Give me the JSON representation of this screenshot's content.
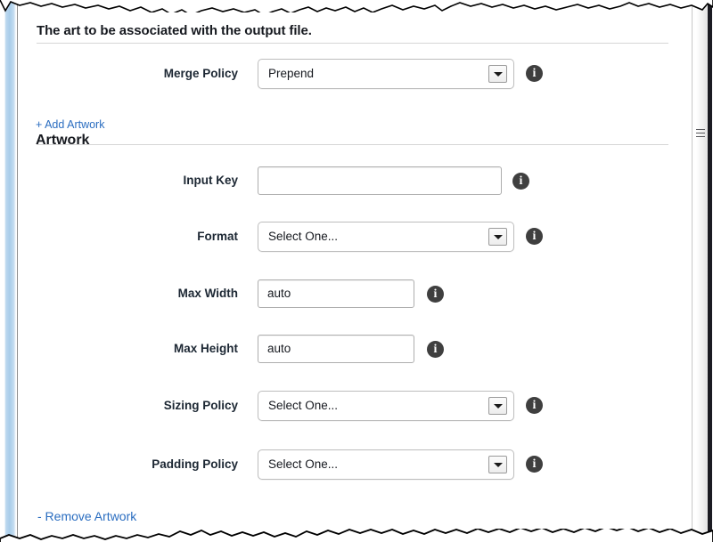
{
  "page": {
    "section_heading": "The art to be associated with the output file.",
    "subsection_heading": "Artwork",
    "add_link": "+ Add Artwork",
    "remove_link": "- Remove Artwork"
  },
  "icons": {
    "info": "info-icon",
    "caret": "chevron-down-icon",
    "scrollbar_grip": "scrollbar-grip-icon"
  },
  "colors": {
    "link": "#2a6dc0",
    "label_text": "#1c2733",
    "rule": "#d6d6d6",
    "info_badge": "#3f3f3f",
    "rail": "#a9cdea"
  },
  "fields": {
    "merge_policy": {
      "label": "Merge Policy",
      "type": "select",
      "value": "Prepend",
      "info": "i"
    },
    "input_key": {
      "label": "Input Key",
      "type": "text",
      "value": "",
      "placeholder": "",
      "info": "i"
    },
    "format": {
      "label": "Format",
      "type": "select",
      "value": "Select One...",
      "info": "i"
    },
    "max_width": {
      "label": "Max Width",
      "type": "text",
      "value": "auto",
      "info": "i"
    },
    "max_height": {
      "label": "Max Height",
      "type": "text",
      "value": "auto",
      "info": "i"
    },
    "sizing_policy": {
      "label": "Sizing Policy",
      "type": "select",
      "value": "Select One...",
      "info": "i"
    },
    "padding_policy": {
      "label": "Padding Policy",
      "type": "select",
      "value": "Select One...",
      "info": "i"
    }
  }
}
